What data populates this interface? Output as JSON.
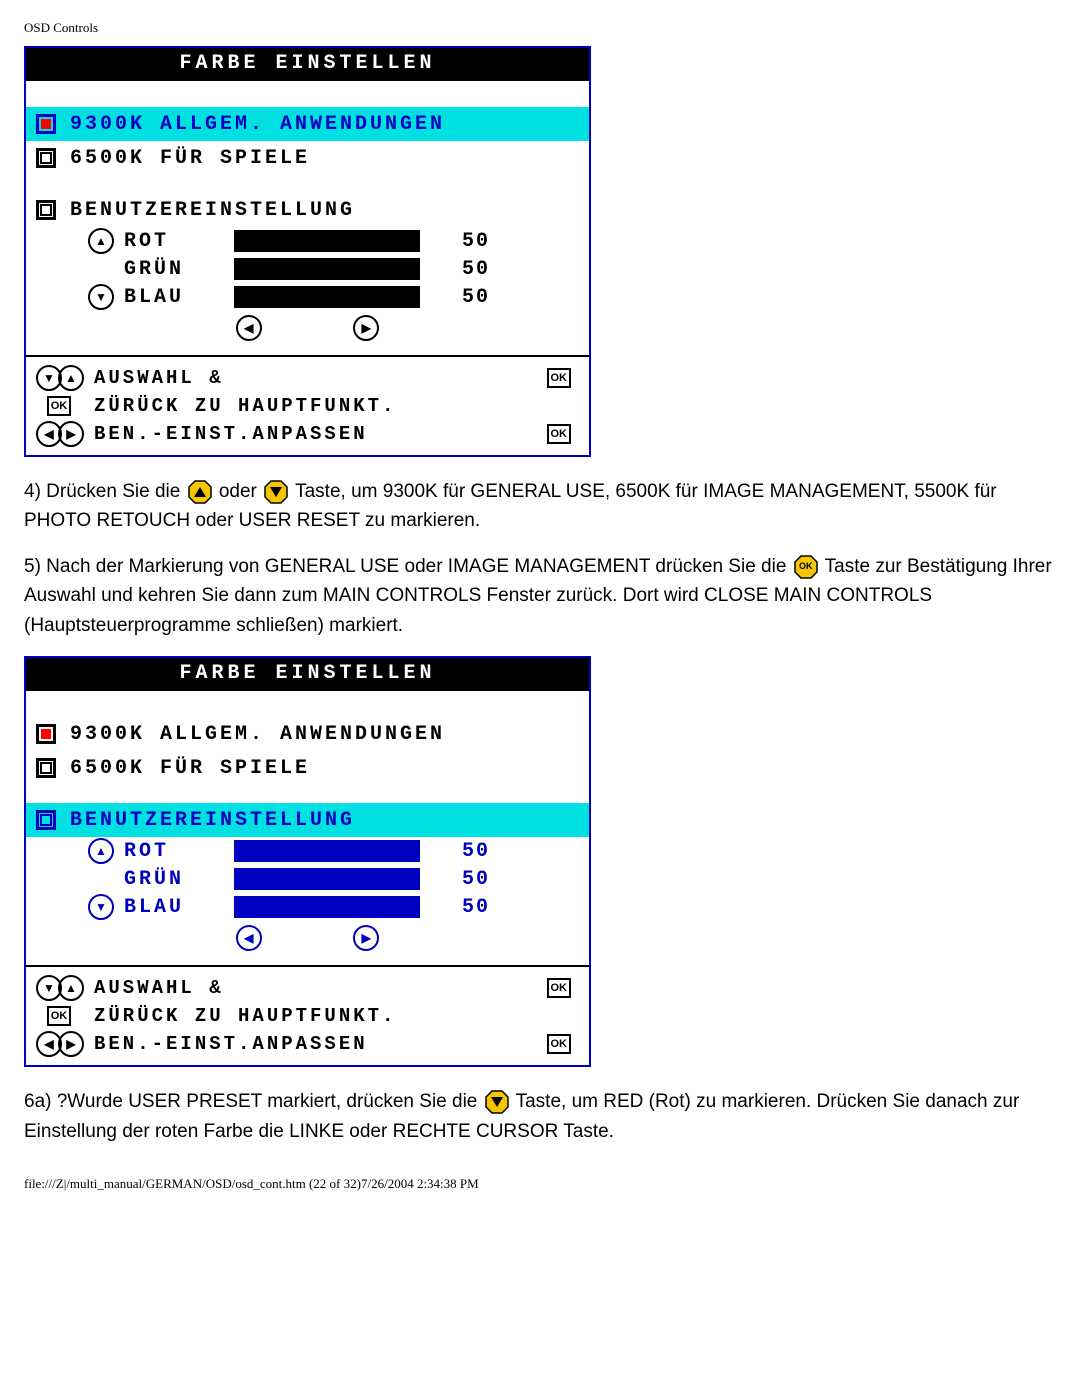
{
  "header": "OSD Controls",
  "osd1": {
    "title": "FARBE EINSTELLEN",
    "opt1": "9300K ALLGEM. ANWENDUNGEN",
    "opt2": "6500K FÜR SPIELE",
    "opt3": "BENUTZEREINSTELLUNG",
    "rgb": {
      "red_label": "ROT",
      "green_label": "GRÜN",
      "blue_label": "BLAU",
      "red_val": "50",
      "green_val": "50",
      "blue_val": "50"
    },
    "help1": "AUSWAHL &",
    "help2": "ZÜRÜCK ZU HAUPTFUNKT.",
    "help3": "BEN.-EINST.ANPASSEN",
    "ok": "OK"
  },
  "para4_a": "4) Drücken Sie die ",
  "para4_b": " oder ",
  "para4_c": " Taste, um 9300K für GENERAL USE, 6500K für IMAGE MANAGEMENT, 5500K für PHOTO RETOUCH oder USER RESET zu markieren.",
  "para5_a": "5) Nach der Markierung von GENERAL USE oder IMAGE MANAGEMENT drücken Sie die ",
  "para5_b": " Taste zur Bestätigung Ihrer Auswahl und kehren Sie dann zum MAIN CONTROLS Fenster zurück. Dort wird CLOSE MAIN CONTROLS (Hauptsteuerprogramme schließen) markiert.",
  "osd2": {
    "title": "FARBE EINSTELLEN",
    "opt1": "9300K ALLGEM. ANWENDUNGEN",
    "opt2": "6500K FÜR SPIELE",
    "opt3": "BENUTZEREINSTELLUNG",
    "rgb": {
      "red_label": "ROT",
      "green_label": "GRÜN",
      "blue_label": "BLAU",
      "red_val": "50",
      "green_val": "50",
      "blue_val": "50"
    },
    "help1": "AUSWAHL &",
    "help2": "ZÜRÜCK ZU HAUPTFUNKT.",
    "help3": "BEN.-EINST.ANPASSEN",
    "ok": "OK"
  },
  "para6_a": "6a) ?Wurde USER PRESET markiert, drücken Sie die ",
  "para6_b": " Taste, um RED (Rot) zu markieren. Drücken Sie danach zur Einstellung der roten Farbe die LINKE oder RECHTE CURSOR Taste.",
  "footer": "file:///Z|/multi_manual/GERMAN/OSD/osd_cont.htm (22 of 32)7/26/2004 2:34:38 PM"
}
